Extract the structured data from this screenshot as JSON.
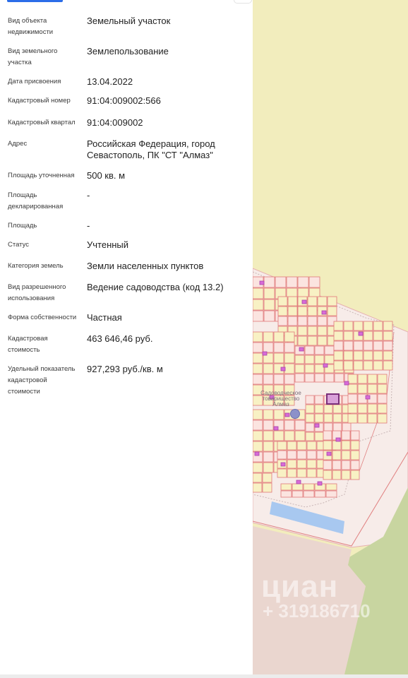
{
  "details": [
    {
      "label": "Вид объекта недвижимости",
      "value": "Земельный участок"
    },
    {
      "label": "Вид земельного участка",
      "value": "Землепользование"
    },
    {
      "label": "Дата присвоения",
      "value": "13.04.2022"
    },
    {
      "label": "Кадастровый номер",
      "value": "91:04:009002:566"
    },
    {
      "label": "Кадастровый квартал",
      "value": "91:04:009002"
    },
    {
      "label": "Адрес",
      "value": "Российская Федерация, город Севастополь, ПК \"СТ \"Алмаз\""
    },
    {
      "label": "Площадь уточненная",
      "value": "500 кв. м"
    },
    {
      "label": "Площадь декларированная",
      "value": "-"
    },
    {
      "label": "Площадь",
      "value": "-"
    },
    {
      "label": "Статус",
      "value": "Учтенный"
    },
    {
      "label": "Категория земель",
      "value": "Земли населенных пунктов"
    },
    {
      "label": "Вид разрешенного использования",
      "value": "Ведение садоводства (код 13.2)"
    },
    {
      "label": "Форма собственности",
      "value": "Частная"
    },
    {
      "label": "Кадастровая стоимость",
      "value": "463 646,46 руб."
    },
    {
      "label": "Удельный показатель кадастровой стоимости",
      "value": "927,293 руб./кв. м"
    }
  ],
  "map": {
    "area_label": "Садоводческое товарищество Алмаз",
    "watermark_brand": "циан",
    "watermark_id": "+ 319186710",
    "colors": {
      "background": "#f2edbd",
      "settlement": "#f7ece9",
      "parcel_stroke": "#e0787a",
      "parcel_fill": "#f8f1c4",
      "selected_parcel": "#8e3b8f",
      "building": "#d86ad8",
      "green": "#c8d5a0",
      "lower": "#ead6cf",
      "water": "#a8c8f0"
    }
  }
}
